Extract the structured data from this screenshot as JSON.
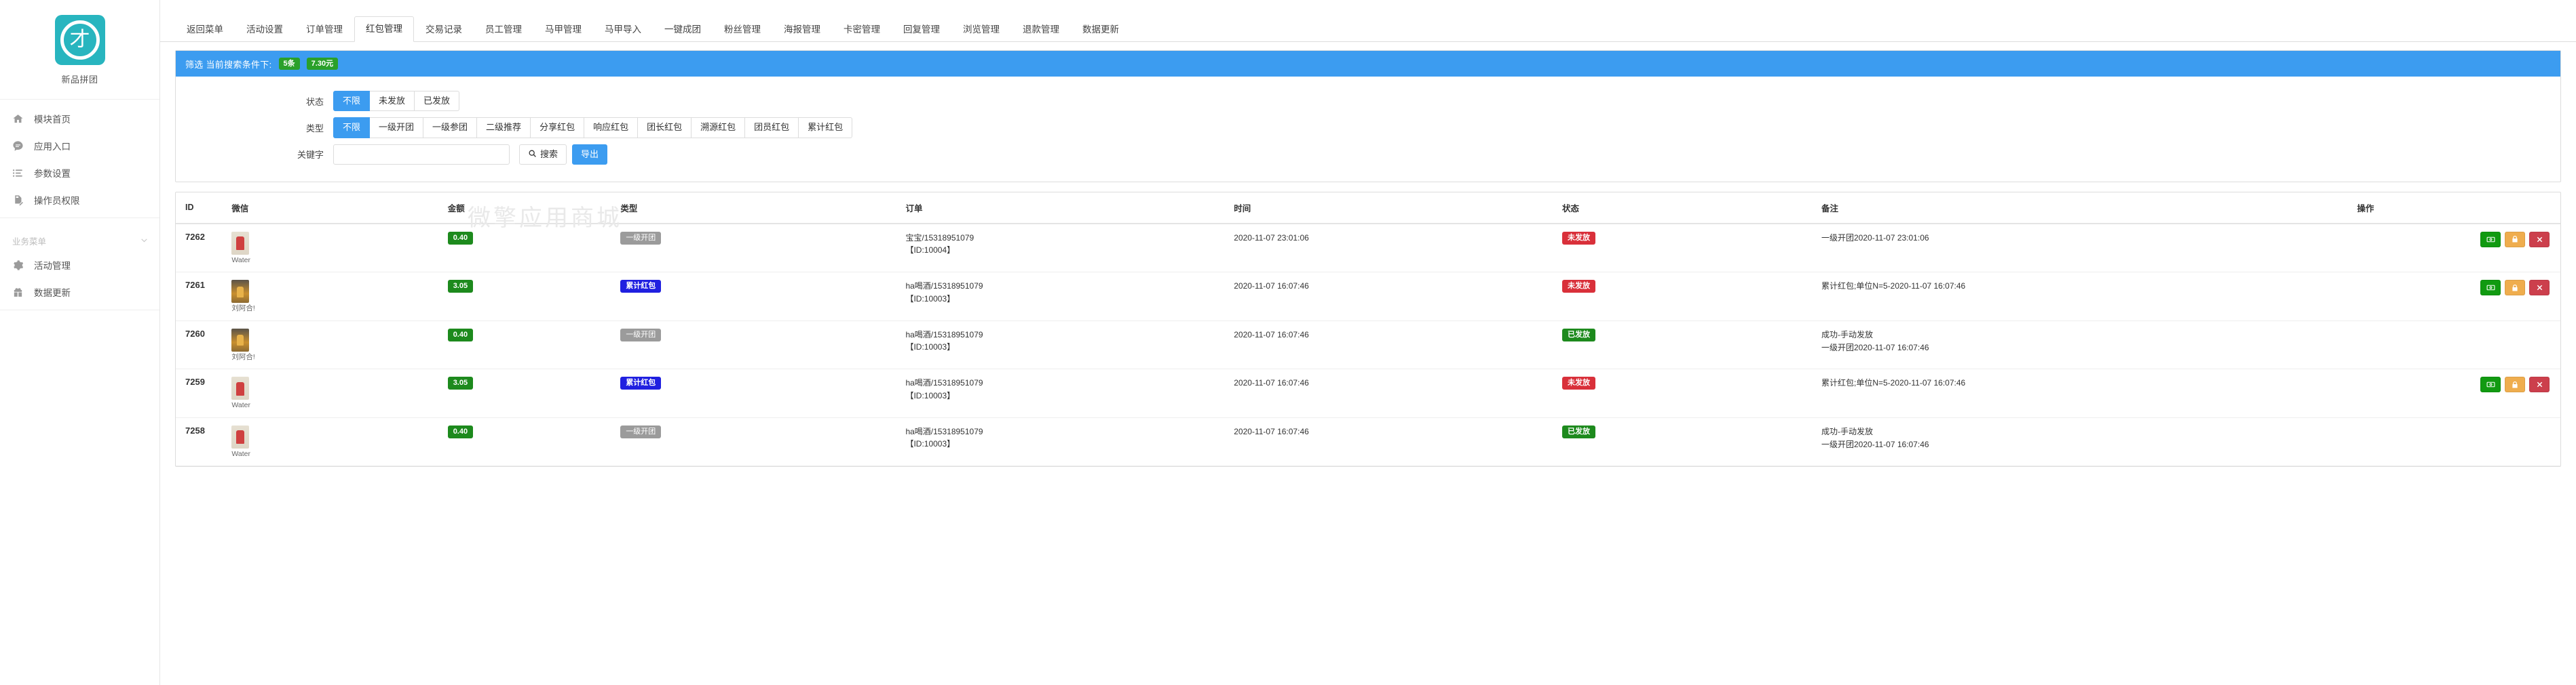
{
  "sidebar": {
    "brand": {
      "name": "新品拼团",
      "logo_glyph": "才",
      "logo_color": "#28b5bf"
    },
    "items": [
      {
        "label": "模块首页",
        "icon": "home-icon"
      },
      {
        "label": "应用入口",
        "icon": "chat-icon"
      },
      {
        "label": "参数设置",
        "icon": "list-icon"
      },
      {
        "label": "操作员权限",
        "icon": "document-edit-icon"
      }
    ],
    "group_title": "业务菜单",
    "group_items": [
      {
        "label": "活动管理",
        "icon": "gear-icon"
      },
      {
        "label": "数据更新",
        "icon": "gift-icon"
      }
    ]
  },
  "tabs": [
    {
      "label": "返回菜单",
      "active": false
    },
    {
      "label": "活动设置",
      "active": false
    },
    {
      "label": "订单管理",
      "active": false
    },
    {
      "label": "红包管理",
      "active": true
    },
    {
      "label": "交易记录",
      "active": false
    },
    {
      "label": "员工管理",
      "active": false
    },
    {
      "label": "马甲管理",
      "active": false
    },
    {
      "label": "马甲导入",
      "active": false
    },
    {
      "label": "一键成团",
      "active": false
    },
    {
      "label": "粉丝管理",
      "active": false
    },
    {
      "label": "海报管理",
      "active": false
    },
    {
      "label": "卡密管理",
      "active": false
    },
    {
      "label": "回复管理",
      "active": false
    },
    {
      "label": "浏览管理",
      "active": false
    },
    {
      "label": "退款管理",
      "active": false
    },
    {
      "label": "数据更新",
      "active": false
    }
  ],
  "filter": {
    "header_lead": "筛选 当前搜索条件下:",
    "count_badge": "5条",
    "amount_badge": "7.30元",
    "status_label": "状态",
    "status_options": [
      {
        "label": "不限",
        "active": true
      },
      {
        "label": "未发放",
        "active": false
      },
      {
        "label": "已发放",
        "active": false
      }
    ],
    "type_label": "类型",
    "type_options": [
      {
        "label": "不限",
        "active": true
      },
      {
        "label": "一级开团",
        "active": false
      },
      {
        "label": "一级参团",
        "active": false
      },
      {
        "label": "二级推荐",
        "active": false
      },
      {
        "label": "分享红包",
        "active": false
      },
      {
        "label": "响应红包",
        "active": false
      },
      {
        "label": "团长红包",
        "active": false
      },
      {
        "label": "溯源红包",
        "active": false
      },
      {
        "label": "团员红包",
        "active": false
      },
      {
        "label": "累计红包",
        "active": false
      }
    ],
    "keyword_label": "关键字",
    "keyword_value": "",
    "keyword_placeholder": "",
    "search_button": "搜索",
    "export_button": "导出"
  },
  "watermark": "微擎应用商城",
  "table": {
    "headers": {
      "id": "ID",
      "wechat": "微信",
      "amount": "金额",
      "type": "类型",
      "order": "订单",
      "time": "时间",
      "status": "状态",
      "remark": "备注",
      "action": "操作"
    },
    "rows": [
      {
        "id": "7262",
        "wechat_name": "Water",
        "avatar_style": "a1",
        "amount": "0.40",
        "type": "一级开团",
        "type_color": "gray",
        "order_main": "宝宝/15318951079",
        "order_sub": "【ID:10004】",
        "time": "2020-11-07 23:01:06",
        "status": "未发放",
        "status_color": "red",
        "remark_lines": [
          "一级开团2020-11-07 23:01:06"
        ],
        "has_actions": true
      },
      {
        "id": "7261",
        "wechat_name": "刘阿合!",
        "avatar_style": "a2",
        "amount": "3.05",
        "type": "累计红包",
        "type_color": "blue",
        "order_main": "ha喝酒/15318951079",
        "order_sub": "【ID:10003】",
        "time": "2020-11-07 16:07:46",
        "status": "未发放",
        "status_color": "red",
        "remark_lines": [
          "累计红包;单位N=5-2020-11-07 16:07:46"
        ],
        "has_actions": true
      },
      {
        "id": "7260",
        "wechat_name": "刘阿合!",
        "avatar_style": "a2",
        "amount": "0.40",
        "type": "一级开团",
        "type_color": "gray",
        "order_main": "ha喝酒/15318951079",
        "order_sub": "【ID:10003】",
        "time": "2020-11-07 16:07:46",
        "status": "已发放",
        "status_color": "green",
        "remark_lines": [
          "成功-手动发放",
          "一级开团2020-11-07 16:07:46"
        ],
        "has_actions": false
      },
      {
        "id": "7259",
        "wechat_name": "Water",
        "avatar_style": "a1",
        "amount": "3.05",
        "type": "累计红包",
        "type_color": "blue",
        "order_main": "ha喝酒/15318951079",
        "order_sub": "【ID:10003】",
        "time": "2020-11-07 16:07:46",
        "status": "未发放",
        "status_color": "red",
        "remark_lines": [
          "累计红包;单位N=5-2020-11-07 16:07:46"
        ],
        "has_actions": true
      },
      {
        "id": "7258",
        "wechat_name": "Water",
        "avatar_style": "a1",
        "amount": "0.40",
        "type": "一级开团",
        "type_color": "gray",
        "order_main": "ha喝酒/15318951079",
        "order_sub": "【ID:10003】",
        "time": "2020-11-07 16:07:46",
        "status": "已发放",
        "status_color": "green",
        "remark_lines": [
          "成功-手动发放",
          "一级开团2020-11-07 16:07:46"
        ],
        "has_actions": false
      }
    ],
    "action_icons": [
      "money-icon",
      "lock-icon",
      "close-icon"
    ]
  }
}
